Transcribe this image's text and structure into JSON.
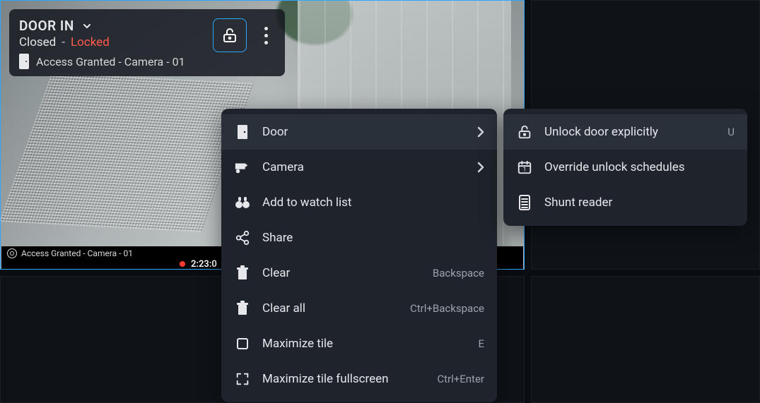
{
  "tile": {
    "title": "DOOR IN",
    "status_closed": "Closed",
    "status_dash": "-",
    "status_locked": "Locked",
    "event_text": "Access Granted - Camera - 01",
    "footer_text": "Access Granted - Camera - 01",
    "recording_time": "2:23:0"
  },
  "colors": {
    "accent": "#2aa8ff",
    "locked": "#ff5a4a"
  },
  "context_menu": {
    "items": [
      {
        "icon": "door-icon",
        "label": "Door",
        "accel": "",
        "arrow": true,
        "hover": true
      },
      {
        "icon": "camera-icon",
        "label": "Camera",
        "accel": "",
        "arrow": true,
        "hover": false
      },
      {
        "icon": "binoculars-icon",
        "label": "Add to watch list",
        "accel": "",
        "arrow": false,
        "hover": false
      },
      {
        "icon": "share-icon",
        "label": "Share",
        "accel": "",
        "arrow": false,
        "hover": false
      },
      {
        "icon": "trash-icon",
        "label": "Clear",
        "accel": "Backspace",
        "arrow": false,
        "hover": false
      },
      {
        "icon": "trash-icon",
        "label": "Clear all",
        "accel": "Ctrl+Backspace",
        "arrow": false,
        "hover": false
      },
      {
        "icon": "square-icon",
        "label": "Maximize tile",
        "accel": "E",
        "arrow": false,
        "hover": false
      },
      {
        "icon": "fullscreen-icon",
        "label": "Maximize tile fullscreen",
        "accel": "Ctrl+Enter",
        "arrow": false,
        "hover": false
      }
    ]
  },
  "submenu": {
    "items": [
      {
        "icon": "unlock-icon",
        "label": "Unlock door explicitly",
        "accel": "U",
        "hover": true
      },
      {
        "icon": "calendar-icon",
        "label": "Override unlock schedules",
        "accel": "",
        "hover": false
      },
      {
        "icon": "reader-icon",
        "label": "Shunt reader",
        "accel": "",
        "hover": false
      }
    ]
  }
}
